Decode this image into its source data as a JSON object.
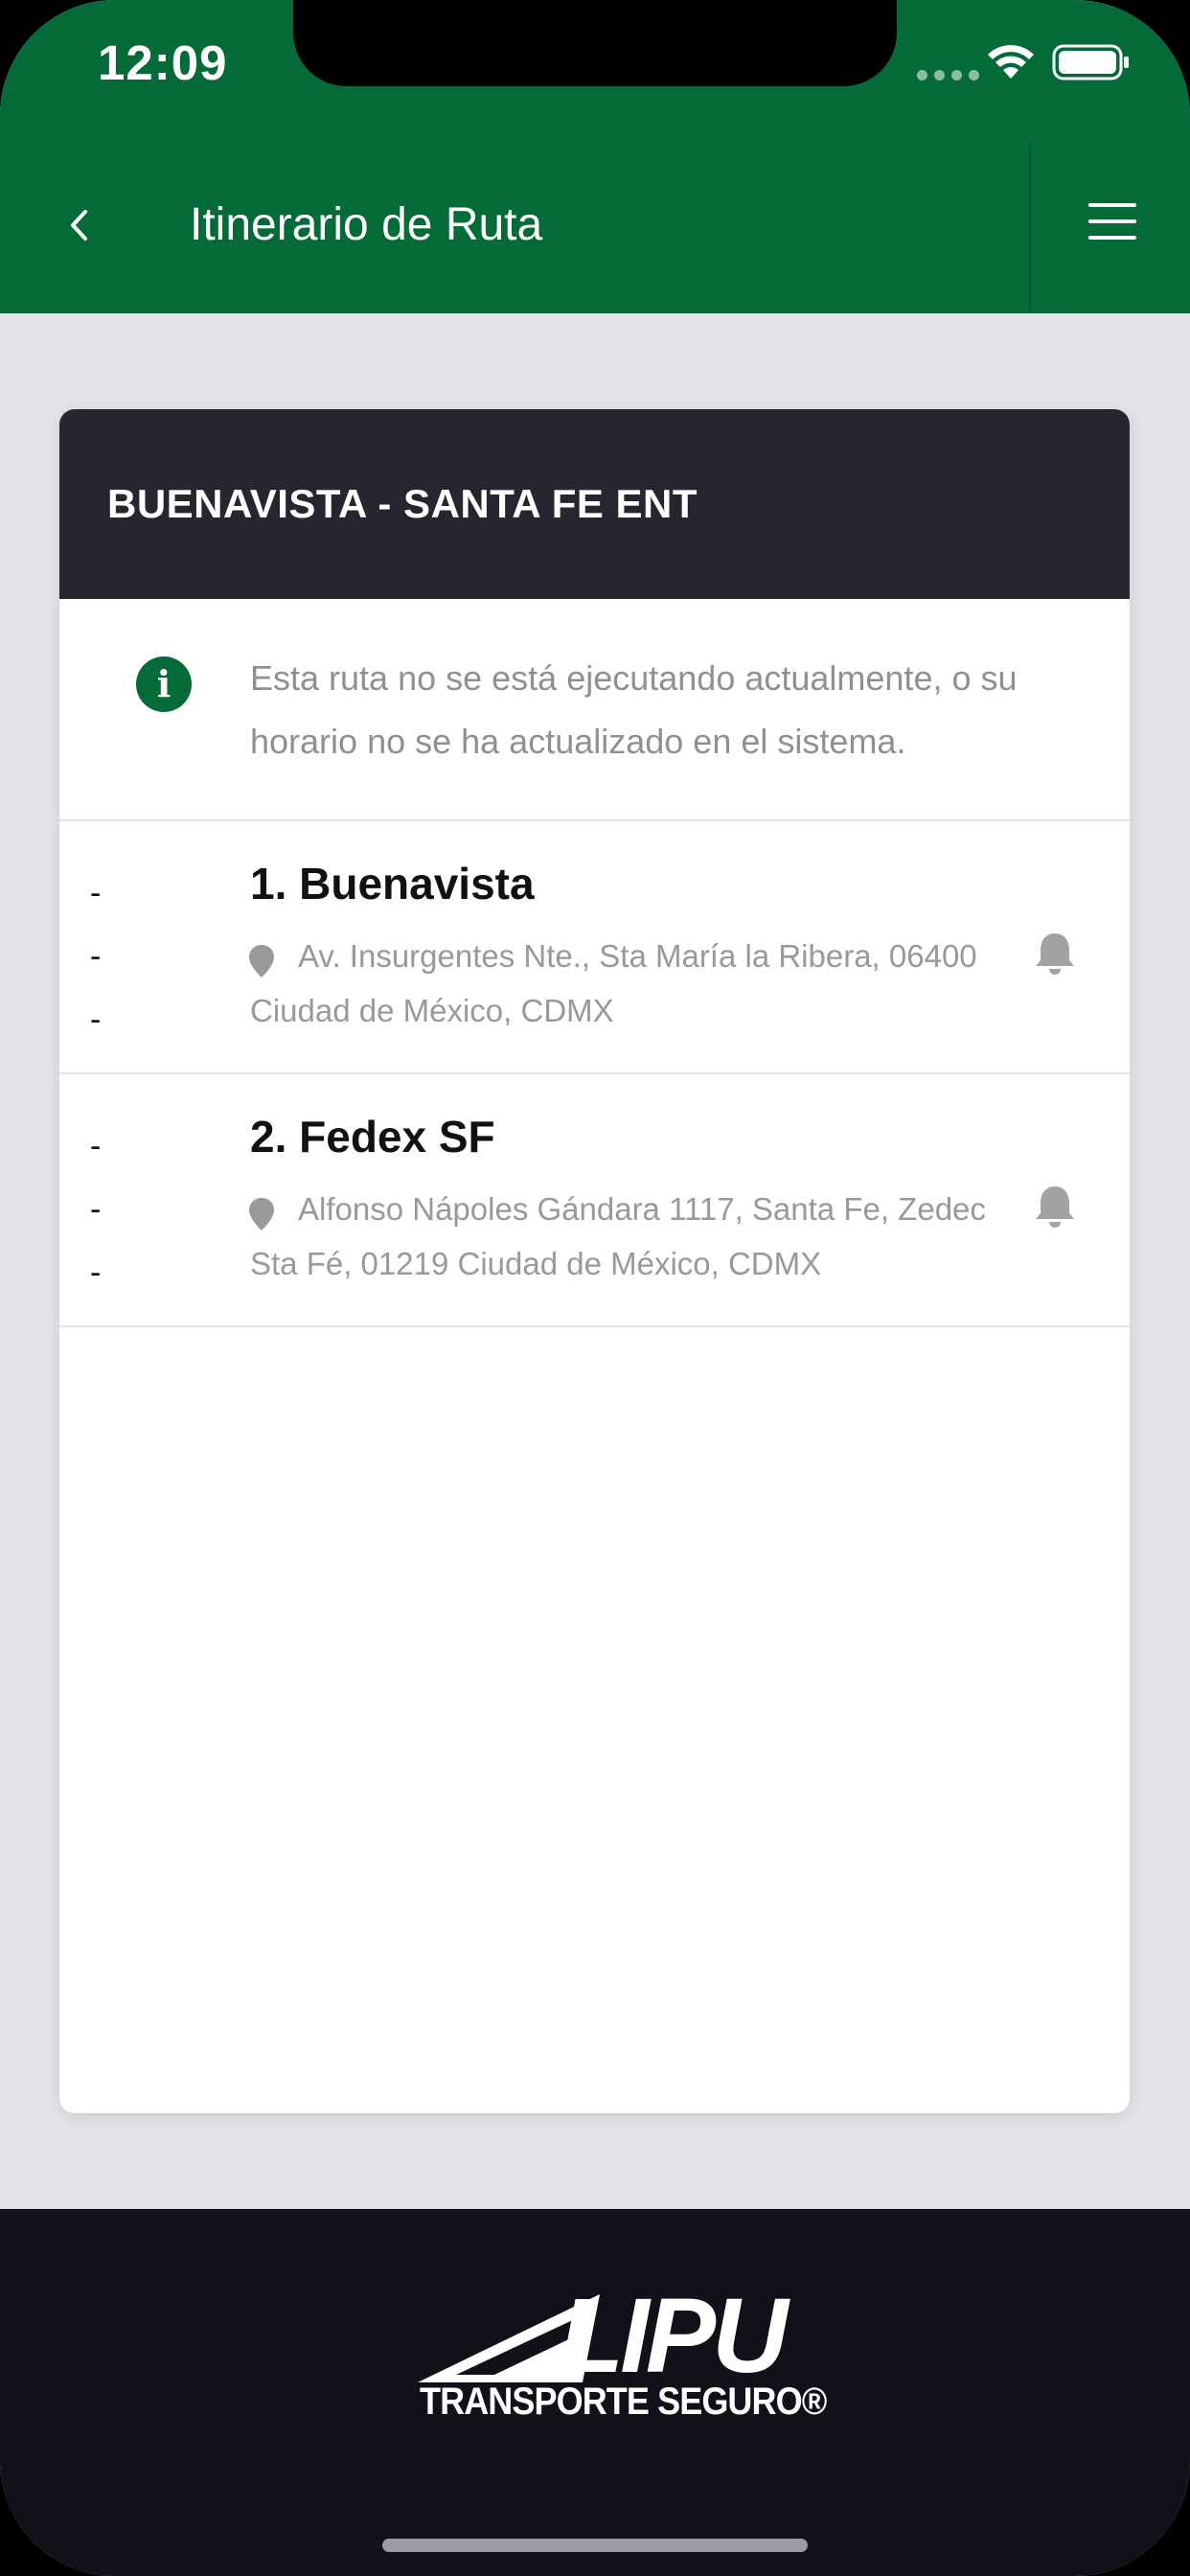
{
  "status_bar": {
    "time": "12:09"
  },
  "nav": {
    "title": "Itinerario de Ruta"
  },
  "route": {
    "name": "BUENAVISTA - SANTA FE ENT",
    "notice": "Esta ruta no se está ejecutando actualmente, o su horario no se ha actualizado en el sistema."
  },
  "stops": [
    {
      "name": "1. Buenavista",
      "address": "Av. Insurgentes Nte., Sta María la Ribera, 06400 Ciudad de México, CDMX",
      "times": [
        "-",
        "-",
        "-"
      ]
    },
    {
      "name": "2. Fedex SF",
      "address": "Alfonso Nápoles Gándara 1117, Santa Fe, Zedec Sta Fé, 01219 Ciudad de México, CDMX",
      "times": [
        "-",
        "-",
        "-"
      ]
    }
  ],
  "footer": {
    "logo_word": "LIPU",
    "logo_tagline": "TRANSPORTE SEGURO®"
  },
  "colors": {
    "brand_green": "#046a37",
    "card_header": "#25262f",
    "footer_bg": "#111119"
  }
}
